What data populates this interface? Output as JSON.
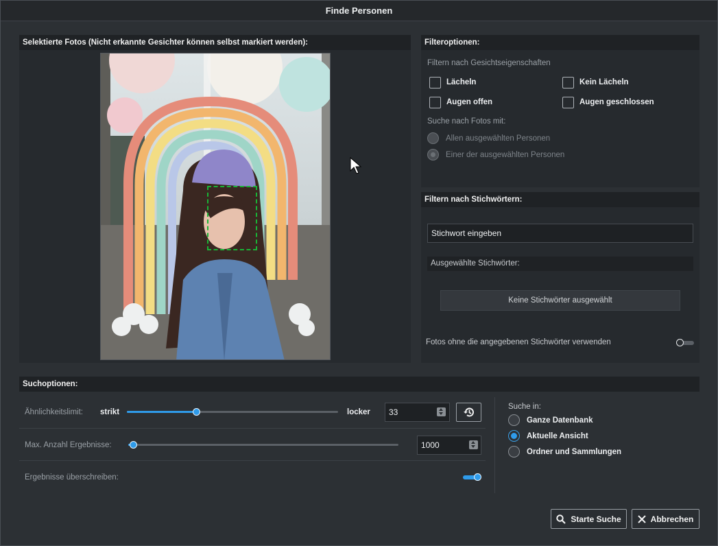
{
  "window": {
    "title": "Finde Personen"
  },
  "photos_panel": {
    "title": "Selektierte Fotos (Nicht erkannte Gesichter können selbst markiert werden):"
  },
  "filter_panel": {
    "title": "Filteroptionen:",
    "face_heading": "Filtern nach Gesichtseigenschaften",
    "checkboxes": [
      {
        "label": "Lächeln",
        "checked": false
      },
      {
        "label": "Kein Lächeln",
        "checked": false
      },
      {
        "label": "Augen offen",
        "checked": false
      },
      {
        "label": "Augen geschlossen",
        "checked": false
      }
    ],
    "search_with_label": "Suche nach Fotos mit:",
    "radios": [
      {
        "label": "Allen ausgewählten Personen",
        "checked": false
      },
      {
        "label": "Einer der ausgewählten Personen",
        "checked": true
      }
    ]
  },
  "keyword_panel": {
    "title": "Filtern nach Stichwörtern:",
    "input_placeholder": "Stichwort eingeben",
    "selected_label": "Ausgewählte Stichwörter:",
    "none_selected_button": "Keine Stichwörter ausgewählt",
    "exclude_label": "Fotos ohne die angegebenen Stichwörter verwenden",
    "exclude_enabled": false
  },
  "search_options": {
    "title": "Suchoptionen:",
    "similarity": {
      "label": "Ähnlichkeitslimit:",
      "min_label": "strikt",
      "max_label": "locker",
      "value": "33",
      "fraction": 0.33
    },
    "max_results": {
      "label": "Max. Anzahl Ergebnisse:",
      "value": "1000",
      "fraction": 0.02
    },
    "overwrite": {
      "label": "Ergebnisse überschreiben:",
      "enabled": true
    },
    "search_in": {
      "label": "Suche in:",
      "options": [
        {
          "label": "Ganze Datenbank",
          "checked": false
        },
        {
          "label": "Aktuelle Ansicht",
          "checked": true
        },
        {
          "label": "Ordner und Sammlungen",
          "checked": false
        }
      ]
    }
  },
  "buttons": {
    "start": "Starte Suche",
    "cancel": "Abbrechen"
  },
  "colors": {
    "accent": "#2f9bea",
    "face_box": "#19b436",
    "window_bg": "#2c3034"
  }
}
